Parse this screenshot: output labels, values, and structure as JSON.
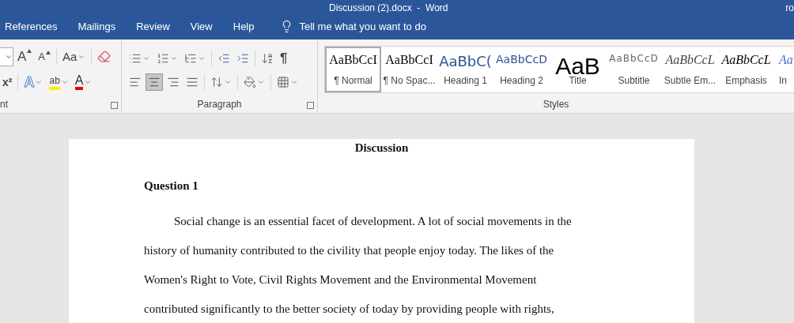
{
  "window": {
    "title": "Discussion (2).docx  -  Word",
    "user": "ro"
  },
  "tabs": [
    {
      "label": "References",
      "selected": false
    },
    {
      "label": "Mailings",
      "selected": false
    },
    {
      "label": "Review",
      "selected": false
    },
    {
      "label": "View",
      "selected": false
    },
    {
      "label": "Help",
      "selected": false
    }
  ],
  "tell_me": {
    "placeholder": "Tell me what you want to do"
  },
  "font_group": {
    "label": "nt",
    "row1": [
      {
        "kind": "size-field"
      },
      {
        "kind": "grow",
        "text": "A"
      },
      {
        "kind": "shrink",
        "text": "A"
      },
      {
        "kind": "case",
        "text": "Aa"
      },
      {
        "kind": "clear"
      }
    ],
    "row2": [
      {
        "kind": "superscript",
        "text": "x²"
      },
      {
        "kind": "effects",
        "text": "A"
      },
      {
        "kind": "highlight",
        "text": "ab"
      },
      {
        "kind": "color",
        "text": "A"
      }
    ]
  },
  "paragraph_group": {
    "label": "Paragraph",
    "row1": [
      {
        "kind": "bullets"
      },
      {
        "kind": "numbering"
      },
      {
        "kind": "multilevel"
      },
      {
        "kind": "outdent"
      },
      {
        "kind": "indent"
      },
      {
        "kind": "sort"
      },
      {
        "kind": "marks",
        "text": "¶"
      }
    ],
    "alignment": [
      {
        "kind": "left",
        "selected": false
      },
      {
        "kind": "center",
        "selected": true
      },
      {
        "kind": "right",
        "selected": false
      },
      {
        "kind": "justify",
        "selected": false
      }
    ],
    "row2": [
      {
        "kind": "spacing"
      },
      {
        "kind": "shading"
      },
      {
        "kind": "borders"
      }
    ]
  },
  "styles_group": {
    "label": "Styles",
    "items": [
      {
        "kind": "normal",
        "preview": "AaBbCcI",
        "label": "¶ Normal",
        "selected": true
      },
      {
        "kind": "nospacing",
        "preview": "AaBbCcI",
        "label": "¶ No Spac...",
        "selected": false
      },
      {
        "kind": "heading1",
        "preview": "AaBbC(",
        "label": "Heading 1",
        "selected": false
      },
      {
        "kind": "heading2",
        "preview": "AaBbCcD",
        "label": "Heading 2",
        "selected": false
      },
      {
        "kind": "title",
        "preview": "AaB",
        "label": "Title",
        "selected": false
      },
      {
        "kind": "subtitle",
        "preview": "AaBbCcD",
        "label": "Subtitle",
        "selected": false
      },
      {
        "kind": "subtle",
        "preview": "AaBbCcL",
        "label": "Subtle Em...",
        "selected": false
      },
      {
        "kind": "emphasis",
        "preview": "AaBbCcL",
        "label": "Emphasis",
        "selected": false
      },
      {
        "kind": "intense",
        "preview": "Aa",
        "label": "In",
        "selected": false
      }
    ]
  },
  "document": {
    "title": "Discussion",
    "heading": "Question 1",
    "paragraph": [
      "Social change is an essential facet of development. A lot of social movements in the",
      "history of humanity contributed to the civility that people enjoy today. The likes of the",
      "Women's Right to Vote, Civil Rights Movement and the Environmental Movement",
      "contributed significantly to the better society of today by providing people with rights,"
    ]
  }
}
